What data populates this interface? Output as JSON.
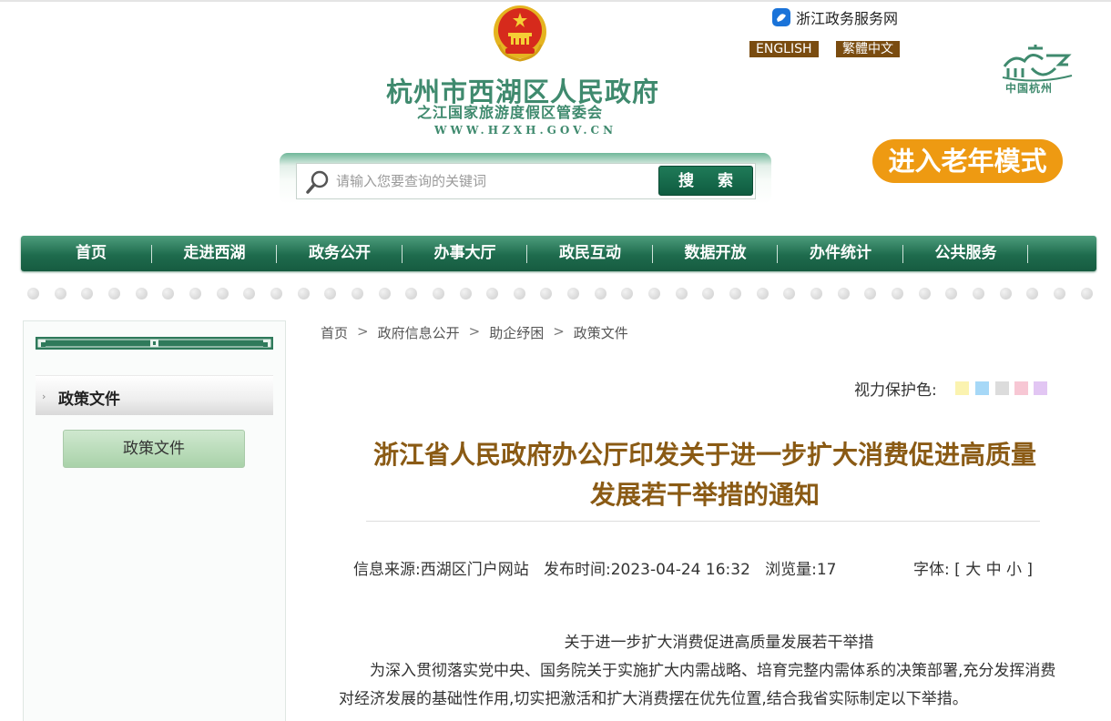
{
  "header": {
    "site_title": "杭州市西湖区人民政府",
    "site_subtitle": "之江国家旅游度假区管委会",
    "site_url": "WWW.HZXH.GOV.CN",
    "portal_link": "浙江政务服务网",
    "lang_english": "ENGLISH",
    "lang_traditional": "繁體中文",
    "city_logo_text": "中国杭州",
    "elder_mode": "进入老年模式"
  },
  "search": {
    "placeholder": "请输入您要查询的关键词",
    "button_label": "搜 索"
  },
  "nav": {
    "items": [
      "首页",
      "走进西湖",
      "政务公开",
      "办事大厅",
      "政民互动",
      "数据开放",
      "办件统计",
      "公共服务"
    ]
  },
  "sidebar": {
    "heading": "政策文件",
    "button_label": "政策文件"
  },
  "breadcrumb": {
    "items": [
      "首页",
      "政府信息公开",
      "助企纾困",
      "政策文件"
    ],
    "separator": ">"
  },
  "vision": {
    "label": "视力保护色:",
    "colors": [
      "#fbf3b0",
      "#a6d8f7",
      "#dcdcdc",
      "#f7c7d4",
      "#e2c6f3"
    ]
  },
  "article": {
    "title": "浙江省人民政府办公厅印发关于进一步扩大消费促进高质量发展若干举措的通知",
    "meta": {
      "source_label": "信息来源:",
      "source": "西湖区门户网站",
      "date_label": "发布时间:",
      "date": "2023-04-24 16:32",
      "views_label": "浏览量:",
      "views": "17"
    },
    "font_size": {
      "label": "字体:",
      "open": "[",
      "large": "大",
      "medium": "中",
      "small": "小",
      "close": "]"
    },
    "body_title": "关于进一步扩大消费促进高质量发展若干举措",
    "paragraph": "为深入贯彻落实党中央、国务院关于实施扩大内需战略、培育完整内需体系的决策部署,充分发挥消费对经济发展的基础性作用,切实把激活和扩大消费摆在优先位置,结合我省实际制定以下举措。"
  },
  "colors": {
    "brand_green": "#1e6b4d",
    "title_brown": "#8a5a14",
    "elder_orange": "#ee9a12",
    "lang_brown": "#7a4c10"
  }
}
